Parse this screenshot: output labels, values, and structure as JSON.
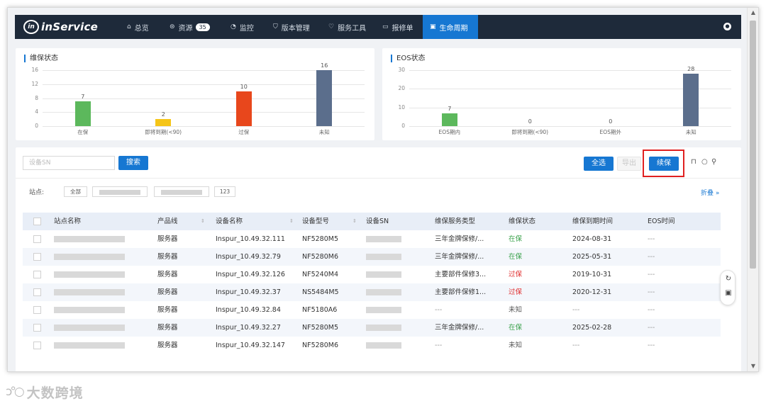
{
  "app": {
    "logo_mark": "in",
    "logo_text": "inService"
  },
  "nav": [
    {
      "label": "总览",
      "icon": "⌂"
    },
    {
      "label": "资源",
      "icon": "⊜",
      "badge": "35"
    },
    {
      "label": "监控",
      "icon": "◔"
    },
    {
      "label": "版本管理",
      "icon": "⛉"
    },
    {
      "label": "服务工具",
      "icon": "♡"
    },
    {
      "label": "报修单",
      "icon": "▭"
    },
    {
      "label": "生命周期",
      "icon": "▣",
      "active": true
    }
  ],
  "user_icon": "●",
  "warranty_chart": {
    "title": "维保状态",
    "chart_data": {
      "type": "bar",
      "categories": [
        "在保",
        "即将到期(<90)",
        "过保",
        "未知"
      ],
      "values": [
        7,
        2,
        10,
        16
      ],
      "colors": [
        "#5cb85c",
        "#f5c518",
        "#e8471c",
        "#5b6e8c"
      ],
      "yticks": [
        0,
        4,
        8,
        12,
        16
      ],
      "ylim": [
        0,
        16
      ]
    }
  },
  "eos_chart": {
    "title": "EOS状态",
    "chart_data": {
      "type": "bar",
      "categories": [
        "EOS期内",
        "即将到期(<90)",
        "EOS期外",
        "未知"
      ],
      "values": [
        7,
        0,
        0,
        28
      ],
      "colors": [
        "#5cb85c",
        "#f5c518",
        "#e8471c",
        "#5b6e8c"
      ],
      "yticks": [
        0,
        10,
        20,
        30
      ],
      "ylim": [
        0,
        30
      ]
    }
  },
  "filter": {
    "search_placeholder": "设备SN",
    "search_button": "搜索",
    "select_all": "全选",
    "export": "导出",
    "renew": "续保",
    "site_label": "站点:",
    "chip_all": "全部",
    "chip_123": "123",
    "collapse": "折叠"
  },
  "table": {
    "headers": [
      "站点名称",
      "产品线",
      "设备名称",
      "设备型号",
      "设备SN",
      "维保服务类型",
      "维保状态",
      "维保到期时间",
      "EOS时间"
    ],
    "rows": [
      {
        "product": "服务器",
        "name": "Inspur_10.49.32.111",
        "model": "NF5280M5",
        "service": "三年金牌保修/...",
        "status": "在保",
        "status_class": "green",
        "expire": "2024-08-31",
        "eos": "---"
      },
      {
        "product": "服务器",
        "name": "Inspur_10.49.32.79",
        "model": "NF5280M6",
        "service": "三年金牌保修/...",
        "status": "在保",
        "status_class": "green",
        "expire": "2025-05-31",
        "eos": "---"
      },
      {
        "product": "服务器",
        "name": "Inspur_10.49.32.126",
        "model": "NF5240M4",
        "service": "主要部件保修3...",
        "status": "过保",
        "status_class": "red",
        "expire": "2019-10-31",
        "eos": "---"
      },
      {
        "product": "服务器",
        "name": "Inspur_10.49.32.37",
        "model": "NS5484M5",
        "service": "主要部件保修1...",
        "status": "过保",
        "status_class": "red",
        "expire": "2020-12-31",
        "eos": "---"
      },
      {
        "product": "服务器",
        "name": "Inspur_10.49.32.84",
        "model": "NF5180A6",
        "service": "---",
        "status": "未知",
        "status_class": "gray",
        "expire": "---",
        "eos": "---"
      },
      {
        "product": "服务器",
        "name": "Inspur_10.49.32.27",
        "model": "NF5280M5",
        "service": "三年金牌保修/...",
        "status": "在保",
        "status_class": "green",
        "expire": "2025-02-28",
        "eos": "---"
      },
      {
        "product": "服务器",
        "name": "Inspur_10.49.32.147",
        "model": "NF5280M6",
        "service": "---",
        "status": "未知",
        "status_class": "gray",
        "expire": "---",
        "eos": "---"
      }
    ]
  },
  "watermark": {
    "text": "大数跨境"
  }
}
